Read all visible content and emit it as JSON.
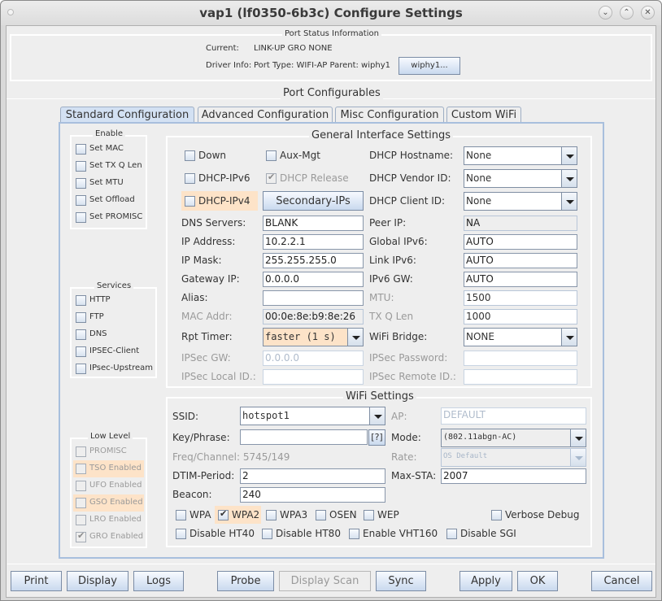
{
  "window": {
    "title": "vap1  (lf0350-6b3c) Configure Settings",
    "controls": [
      "minimize",
      "maximize",
      "close"
    ]
  },
  "port_status": {
    "group_title": "Port Status Information",
    "current_label": "Current:",
    "current_value": "LINK-UP GRO  NONE",
    "driver_label": "Driver Info:",
    "driver_value": "Port Type: WIFI-AP   Parent: wiphy1",
    "parent_button": "wiphy1..."
  },
  "configurables_title": "Port Configurables",
  "tabs": [
    {
      "label": "Standard Configuration",
      "active": true
    },
    {
      "label": "Advanced Configuration",
      "active": false
    },
    {
      "label": "Misc Configuration",
      "active": false
    },
    {
      "label": "Custom WiFi",
      "active": false
    }
  ],
  "enable": {
    "title": "Enable",
    "items": [
      {
        "label": "Set MAC",
        "checked": false
      },
      {
        "label": "Set TX Q Len",
        "checked": false
      },
      {
        "label": "Set MTU",
        "checked": false
      },
      {
        "label": "Set Offload",
        "checked": false
      },
      {
        "label": "Set PROMISC",
        "checked": false
      }
    ]
  },
  "services": {
    "title": "Services",
    "items": [
      {
        "label": "HTTP",
        "checked": false
      },
      {
        "label": "FTP",
        "checked": false
      },
      {
        "label": "DNS",
        "checked": false
      },
      {
        "label": "IPSEC-Client",
        "checked": false
      },
      {
        "label": "IPsec-Upstream",
        "checked": false
      }
    ]
  },
  "low_level": {
    "title": "Low Level",
    "items": [
      {
        "label": "PROMISC",
        "checked": false,
        "highlight": false
      },
      {
        "label": "TSO Enabled",
        "checked": false,
        "highlight": true
      },
      {
        "label": "UFO Enabled",
        "checked": false,
        "highlight": false
      },
      {
        "label": "GSO Enabled",
        "checked": false,
        "highlight": true
      },
      {
        "label": "LRO Enabled",
        "checked": false,
        "highlight": false
      },
      {
        "label": "GRO Enabled",
        "checked": true,
        "highlight": false
      }
    ]
  },
  "general": {
    "title": "General Interface Settings",
    "down": "Down",
    "aux_mgt": "Aux-Mgt",
    "dhcp_ipv6": "DHCP-IPv6",
    "dhcp_release": "DHCP Release",
    "dhcp_ipv4": "DHCP-IPv4",
    "secondary_ips": "Secondary-IPs",
    "dhcp_hostname_label": "DHCP Hostname:",
    "dhcp_hostname": "None",
    "dhcp_vendor_label": "DHCP Vendor ID:",
    "dhcp_vendor": "None",
    "dhcp_client_label": "DHCP Client ID:",
    "dhcp_client": "None",
    "dns_label": "DNS Servers:",
    "dns": "BLANK",
    "peer_ip_label": "Peer IP:",
    "peer_ip": "NA",
    "ip_label": "IP Address:",
    "ip": "10.2.2.1",
    "global_ipv6_label": "Global IPv6:",
    "global_ipv6": "AUTO",
    "mask_label": "IP Mask:",
    "mask": "255.255.255.0",
    "link_ipv6_label": "Link IPv6:",
    "link_ipv6": "AUTO",
    "gateway_label": "Gateway IP:",
    "gateway": "0.0.0.0",
    "ipv6_gw_label": "IPv6 GW:",
    "ipv6_gw": "AUTO",
    "alias_label": "Alias:",
    "alias": "",
    "mtu_label": "MTU:",
    "mtu": "1500",
    "mac_label": "MAC Addr:",
    "mac": "00:0e:8e:b9:8e:26",
    "txq_label": "TX Q Len",
    "txq": "1000",
    "rpt_label": "Rpt Timer:",
    "rpt": "faster  (1 s)",
    "bridge_label": "WiFi Bridge:",
    "bridge": "NONE",
    "ipsec_gw_label": "IPSec GW:",
    "ipsec_gw": "0.0.0.0",
    "ipsec_pw_label": "IPSec Password:",
    "ipsec_pw": "",
    "ipsec_local_label": "IPSec Local ID.:",
    "ipsec_local": "",
    "ipsec_remote_label": "IPSec Remote ID.:",
    "ipsec_remote": ""
  },
  "wifi": {
    "title": "WiFi Settings",
    "ssid_label": "SSID:",
    "ssid": "hotspot1",
    "ap_label": "AP:",
    "ap": "DEFAULT",
    "key_label": "Key/Phrase:",
    "key": "",
    "key_help": "[?]",
    "mode_label": "Mode:",
    "mode": "(802.11abgn-AC)",
    "freq_text": "Freq/Channel: 5745/149",
    "rate_label": "Rate:",
    "rate": "OS Default",
    "dtim_label": "DTIM-Period:",
    "dtim": "2",
    "maxsta_label": "Max-STA:",
    "maxsta": "2007",
    "beacon_label": "Beacon:",
    "beacon": "240",
    "wpa": "WPA",
    "wpa2": "WPA2",
    "wpa3": "WPA3",
    "osen": "OSEN",
    "wep": "WEP",
    "verbose": "Verbose Debug",
    "ht40": "Disable HT40",
    "ht80": "Disable HT80",
    "vht160": "Enable VHT160",
    "sgi": "Disable SGI",
    "wpa2_checked": true
  },
  "buttons": {
    "print": "Print",
    "display": "Display",
    "logs": "Logs",
    "probe": "Probe",
    "display_scan": "Display Scan",
    "sync": "Sync",
    "apply": "Apply",
    "ok": "OK",
    "cancel": "Cancel"
  },
  "colors": {
    "highlight": "#fde3c8",
    "tab_active": "#d3e1f3",
    "panel_border": "#a8bfdd"
  }
}
